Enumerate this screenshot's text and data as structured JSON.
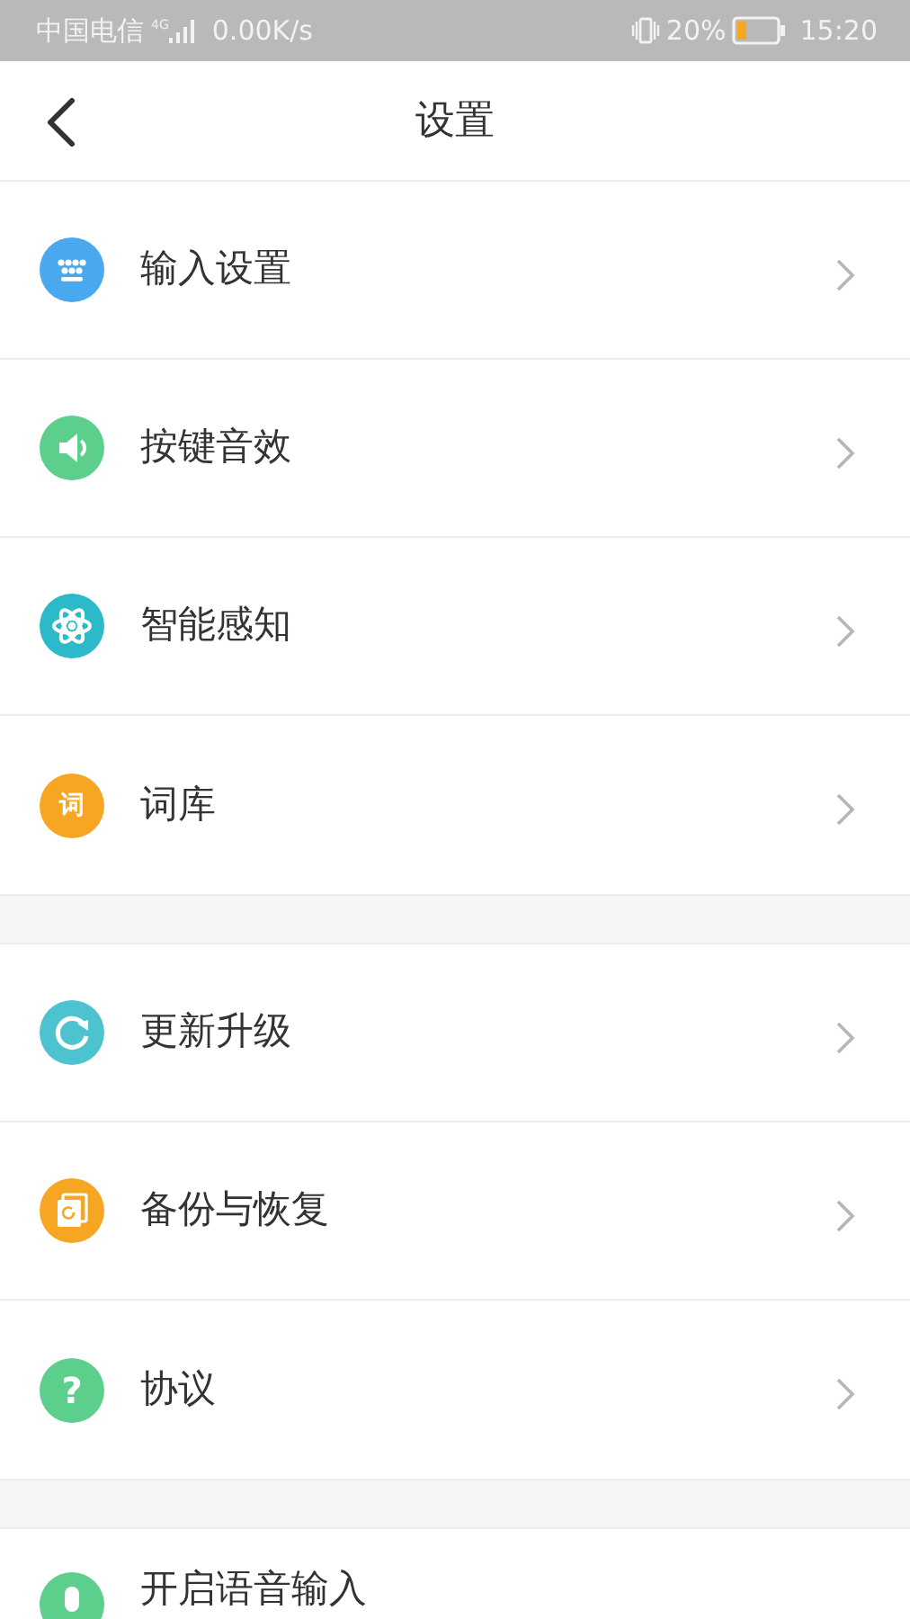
{
  "status_bar": {
    "carrier": "中国电信",
    "network": "4G",
    "speed": "0.00K/s",
    "battery": "20%",
    "time": "15:20"
  },
  "header": {
    "title": "设置"
  },
  "groups": [
    {
      "items": [
        {
          "label": "输入设置",
          "kind": "keyboard",
          "color": "#4aa8ee"
        },
        {
          "label": "按键音效",
          "kind": "speaker",
          "color": "#5ccf8c"
        },
        {
          "label": "智能感知",
          "kind": "atom",
          "color": "#2cb9c9"
        },
        {
          "label": "词库",
          "kind": "glyph",
          "glyph": "词",
          "color": "#f6a623"
        }
      ]
    },
    {
      "items": [
        {
          "label": "更新升级",
          "kind": "refresh",
          "color": "#4cc3cf"
        },
        {
          "label": "备份与恢复",
          "kind": "backup",
          "color": "#f6a623"
        },
        {
          "label": "协议",
          "kind": "glyph",
          "glyph": "?",
          "color": "#5ccf8c"
        }
      ]
    },
    {
      "items": [
        {
          "label": "开启语音输入",
          "kind": "mic",
          "color": "#5ccf8c"
        }
      ]
    }
  ]
}
